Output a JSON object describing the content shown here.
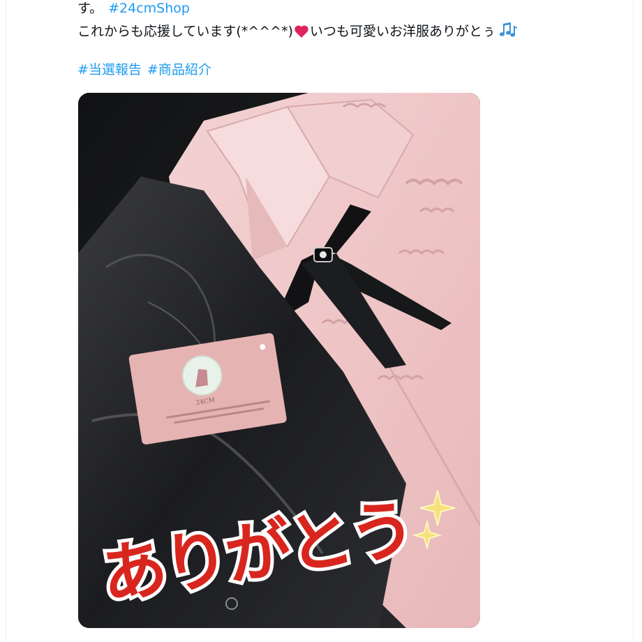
{
  "tweet": {
    "line1_prefix": "す。",
    "line1_hashtag": "#24cmShop",
    "line2_before_heart": "これからも応援しています(*^^^*)",
    "line2_after_heart": "いつも可愛いお洋服ありがとぅ",
    "hashtag_1": "#当選報告",
    "hashtag_2": "#商品紹介"
  },
  "photo": {
    "overlay_text": "ありがとう",
    "tag_logo_text": "24CM"
  },
  "colors": {
    "hashtag": "#1d9bf0",
    "heart": "#e0245e",
    "notes": "#3b94d9",
    "overlay_red": "#d8261f",
    "blouse_pink": "#efc9c9",
    "tag_pink": "#e6b3b3"
  },
  "icons": [
    "heart-emoji-icon",
    "music-notes-icon",
    "sparkle-icon"
  ]
}
